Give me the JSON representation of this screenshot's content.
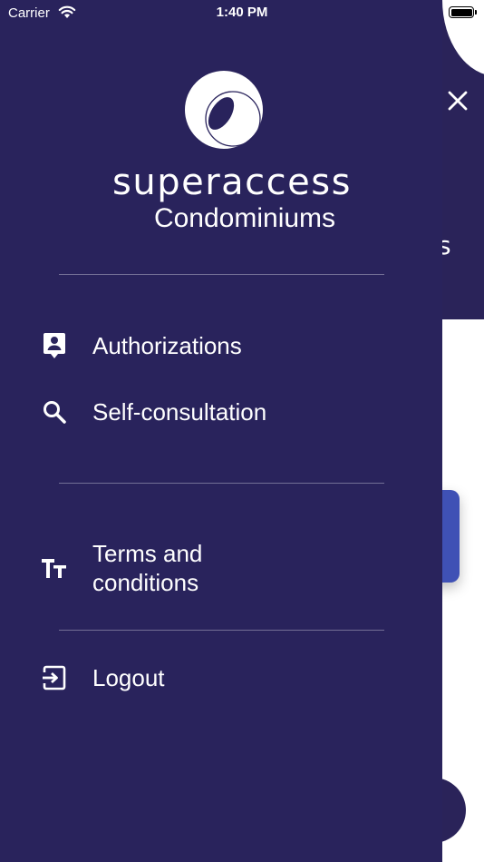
{
  "status_bar": {
    "carrier": "Carrier",
    "time": "1:40 PM",
    "battery_level": 1.0
  },
  "brand": {
    "name": "superaccess",
    "subtitle": "Condominiums"
  },
  "menu": {
    "items": [
      {
        "label": "Authorizations",
        "icon": "contact-badge-icon"
      },
      {
        "label": "Self-consultation",
        "icon": "search-icon"
      },
      {
        "label": "Terms and\nconditions",
        "icon": "text-size-icon"
      },
      {
        "label": "Logout",
        "icon": "logout-icon"
      }
    ]
  },
  "background": {
    "fragment_text": "s"
  },
  "colors": {
    "drawer": "#29235c",
    "accent_button": "#3f51b5",
    "text": "#ffffff"
  }
}
